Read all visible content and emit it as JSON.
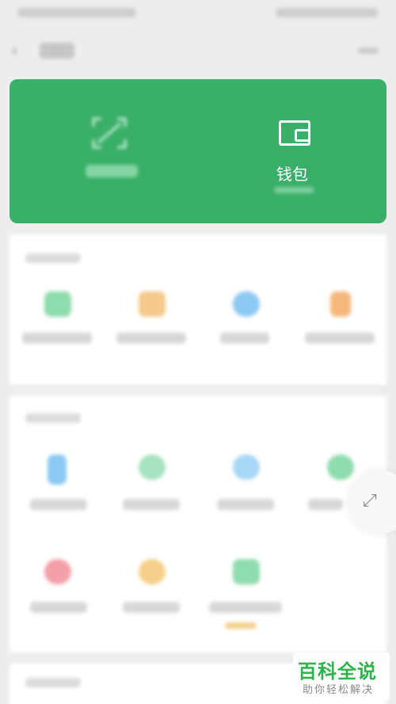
{
  "wallet": {
    "label": "钱包"
  },
  "watermark": {
    "title": "百科全说",
    "subtitle": "助你轻松解决"
  },
  "colors": {
    "primary_green": "#3aaf69",
    "icon_green": "#8fdcae",
    "icon_orange": "#f5c98a",
    "icon_blue": "#8cc8f3",
    "icon_red": "#f3a0a8",
    "watermark_green": "#2db34a"
  },
  "icons": [
    "back-icon",
    "more-icon",
    "scan-icon",
    "wallet-icon",
    "float-action-icon"
  ]
}
